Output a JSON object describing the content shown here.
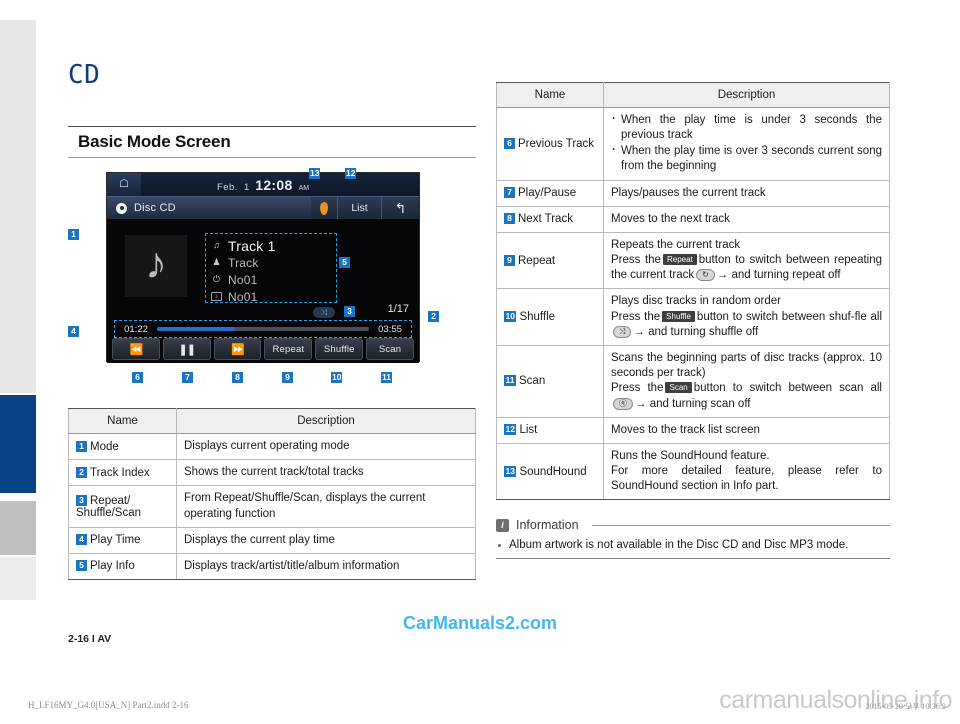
{
  "chapter": {
    "title": "CD"
  },
  "section": {
    "title": "Basic Mode Screen"
  },
  "device": {
    "home_icon": "home-icon",
    "clock": {
      "month": "Feb.",
      "day": "1",
      "time": "12:08",
      "ampm": "AM"
    },
    "mode_label": "Disc CD",
    "soundhound_icon": "soundhound-icon",
    "list_label": "List",
    "back_icon": "back-arrow-icon",
    "album_art_icon": "music-note-icon",
    "play_info": [
      {
        "icon": "music-note-icon",
        "glyph": "♫",
        "text": "Track 1"
      },
      {
        "icon": "artist-icon",
        "glyph": "♟",
        "text": "Track"
      },
      {
        "icon": "title-icon",
        "glyph": "●",
        "text": "No01"
      },
      {
        "icon": "album-icon",
        "glyph": "♪",
        "text": "No01"
      }
    ],
    "shuffle_indicator": "⤨",
    "track_index": "1/17",
    "elapsed": "01:22",
    "total": "03:55",
    "progress_percent": 37,
    "controls": [
      {
        "name": "previous-track-button",
        "glyph": "⏮",
        "label": ""
      },
      {
        "name": "play-pause-button",
        "glyph": "▐▌",
        "label": ""
      },
      {
        "name": "next-track-button",
        "glyph": "⏭",
        "label": ""
      },
      {
        "name": "repeat-button",
        "glyph": "",
        "label": "Repeat"
      },
      {
        "name": "shuffle-button",
        "glyph": "",
        "label": "Shuffle"
      },
      {
        "name": "scan-button",
        "glyph": "",
        "label": "Scan"
      }
    ],
    "callouts": [
      "1",
      "2",
      "3",
      "4",
      "5",
      "6",
      "7",
      "8",
      "9",
      "10",
      "11",
      "12",
      "13"
    ]
  },
  "table_left": {
    "headers": [
      "Name",
      "Description"
    ],
    "rows": [
      {
        "num": "1",
        "name": "Mode",
        "desc": "Displays current operating mode"
      },
      {
        "num": "2",
        "name": "Track Index",
        "desc": "Shows the current track/total tracks"
      },
      {
        "num": "3",
        "name": "Repeat/\nShuffle/Scan",
        "desc": "From Repeat/Shuffle/Scan, displays the current operating function"
      },
      {
        "num": "4",
        "name": "Play Time",
        "desc": "Displays the current play time"
      },
      {
        "num": "5",
        "name": "Play Info",
        "desc": "Displays track/artist/title/album information"
      }
    ]
  },
  "table_right": {
    "headers": [
      "Name",
      "Description"
    ],
    "rows": [
      {
        "num": "6",
        "name": "Previous Track",
        "bullets": [
          "When the play time is under 3 seconds the previous track",
          "When the play time is over 3 seconds current song from the beginning"
        ]
      },
      {
        "num": "7",
        "name": "Play/Pause",
        "desc": "Plays/pauses the current track"
      },
      {
        "num": "8",
        "name": "Next Track",
        "desc": "Moves to the next track"
      },
      {
        "num": "9",
        "name": "Repeat",
        "line1": "Repeats the current track",
        "pre": "Press the",
        "key": "Repeat",
        "post": "button to switch between repeating the current track",
        "pill": "↻",
        "tail": "→ and turning repeat off"
      },
      {
        "num": "10",
        "name": "Shuffle",
        "line1": "Plays disc tracks in random order",
        "pre": "Press the",
        "key": "Shuffle",
        "post": "button to switch between shuf-fle all",
        "pill": "⤨",
        "tail": "→ and turning shuffle off"
      },
      {
        "num": "11",
        "name": "Scan",
        "line1": "Scans the beginning parts of disc tracks (approx. 10 seconds per track)",
        "pre": "Press the",
        "key": "Scan",
        "post": "button to switch between scan all",
        "pill": "ⓠ",
        "tail": "→ and turning scan off"
      },
      {
        "num": "12",
        "name": "List",
        "desc": "Moves to the track list screen"
      },
      {
        "num": "13",
        "name": "SoundHound",
        "line1": "Runs the SoundHound feature.",
        "line2": "For more detailed feature, please refer to SoundHound section in Info part."
      }
    ]
  },
  "information": {
    "icon": "info-icon",
    "title": "Information",
    "items": [
      "Album artwork is not available in the Disc CD and Disc MP3 mode."
    ]
  },
  "footer": {
    "watermark_top": "CarManuals2.com",
    "folio": "2-16 I AV",
    "imprint_left": "H_LF16MY_G4.0[USA_N] Part2.indd   2-16",
    "imprint_right": "2015-05-20   오후 10:36:2",
    "watermark_bottom": "carmanualsonline.info"
  },
  "colors": {
    "accent_blue": "#1a74bf",
    "title_blue": "#123b7a",
    "tab_blue": "#0a4286",
    "watermark_cyan": "#45b6f0"
  }
}
